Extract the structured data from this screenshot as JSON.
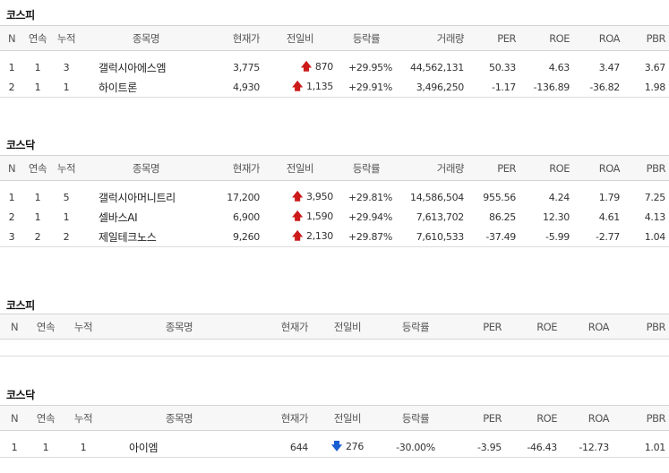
{
  "sections": [
    {
      "title": "코스피",
      "headers": [
        "N",
        "연속",
        "누적",
        "종목명",
        "현재가",
        "전일비",
        "등락률",
        "거래량",
        "PER",
        "ROE",
        "ROA",
        "PBR"
      ],
      "rows": [
        {
          "n": "1",
          "streak": "1",
          "total": "3",
          "name": "갤럭시아에스엠",
          "price": "3,775",
          "dir": "up",
          "change": "870",
          "rate": "+29.95%",
          "volume": "44,562,131",
          "per": "50.33",
          "roe": "4.63",
          "roa": "3.47",
          "pbr": "3.67"
        },
        {
          "n": "2",
          "streak": "1",
          "total": "1",
          "name": "하이트론",
          "price": "4,930",
          "dir": "up",
          "change": "1,135",
          "rate": "+29.91%",
          "volume": "3,496,250",
          "per": "-1.17",
          "roe": "-136.89",
          "roa": "-36.82",
          "pbr": "1.98"
        }
      ]
    },
    {
      "title": "코스닥",
      "headers": [
        "N",
        "연속",
        "누적",
        "종목명",
        "현재가",
        "전일비",
        "등락률",
        "거래량",
        "PER",
        "ROE",
        "ROA",
        "PBR"
      ],
      "rows": [
        {
          "n": "1",
          "streak": "1",
          "total": "5",
          "name": "갤럭시아머니트리",
          "price": "17,200",
          "dir": "up",
          "change": "3,950",
          "rate": "+29.81%",
          "volume": "14,586,504",
          "per": "955.56",
          "roe": "4.24",
          "roa": "1.79",
          "pbr": "7.25"
        },
        {
          "n": "2",
          "streak": "1",
          "total": "1",
          "name": "셀바스AI",
          "price": "6,900",
          "dir": "up",
          "change": "1,590",
          "rate": "+29.94%",
          "volume": "7,613,702",
          "per": "86.25",
          "roe": "12.30",
          "roa": "4.61",
          "pbr": "4.13"
        },
        {
          "n": "3",
          "streak": "2",
          "total": "2",
          "name": "제일테크노스",
          "price": "9,260",
          "dir": "up",
          "change": "2,130",
          "rate": "+29.87%",
          "volume": "7,610,533",
          "per": "-37.49",
          "roe": "-5.99",
          "roa": "-2.77",
          "pbr": "1.04"
        }
      ]
    },
    {
      "title": "코스피",
      "headers": [
        "N",
        "연속",
        "누적",
        "종목명",
        "현재가",
        "전일비",
        "등락률",
        "PER",
        "ROE",
        "ROA",
        "PBR"
      ],
      "rows": []
    },
    {
      "title": "코스닥",
      "headers": [
        "N",
        "연속",
        "누적",
        "종목명",
        "현재가",
        "전일비",
        "등락률",
        "PER",
        "ROE",
        "ROA",
        "PBR"
      ],
      "rows": [
        {
          "n": "1",
          "streak": "1",
          "total": "1",
          "name": "아이엠",
          "price": "644",
          "dir": "down",
          "change": "276",
          "rate": "-30.00%",
          "per": "-3.95",
          "roe": "-46.43",
          "roa": "-12.73",
          "pbr": "1.01"
        }
      ]
    }
  ],
  "icons": {
    "up": "arrow-up-icon",
    "down": "arrow-down-icon"
  },
  "colors": {
    "up": "#cc1a1a",
    "down": "#1a5fd1",
    "header_bg": "#f7f7f7"
  }
}
